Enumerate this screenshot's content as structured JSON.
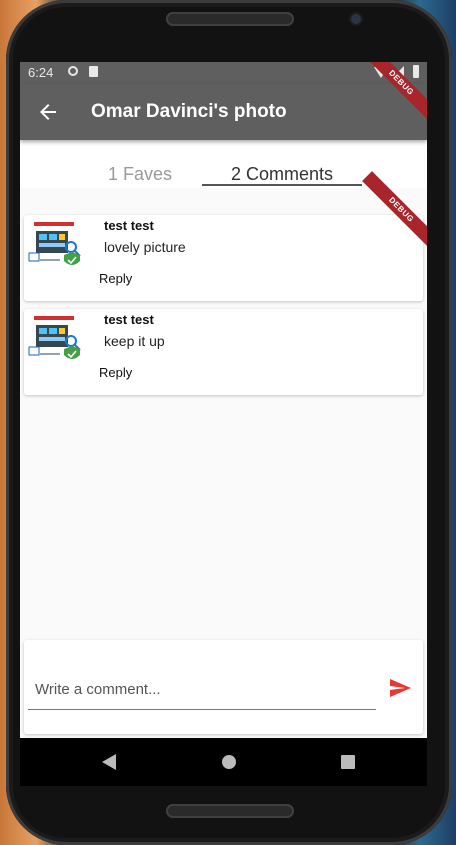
{
  "status_bar": {
    "time": "6:24"
  },
  "app_bar": {
    "title": "Omar Davinci's photo",
    "back_icon": "arrow-back-icon"
  },
  "tabs": [
    {
      "label": "1 Faves",
      "active": false
    },
    {
      "label": "2 Comments",
      "active": true
    }
  ],
  "comments": [
    {
      "author": "test test",
      "text": "lovely picture",
      "reply_label": "Reply"
    },
    {
      "author": "test test",
      "text": "keep it up",
      "reply_label": "Reply"
    }
  ],
  "debug_banner": "DEBUG",
  "composer": {
    "placeholder": "Write a comment...",
    "send_icon": "send-icon",
    "send_color": "#e53935"
  },
  "colors": {
    "app_bar": "#5f5f5f",
    "debug_banner": "#a8262b",
    "accent": "#e53935"
  }
}
